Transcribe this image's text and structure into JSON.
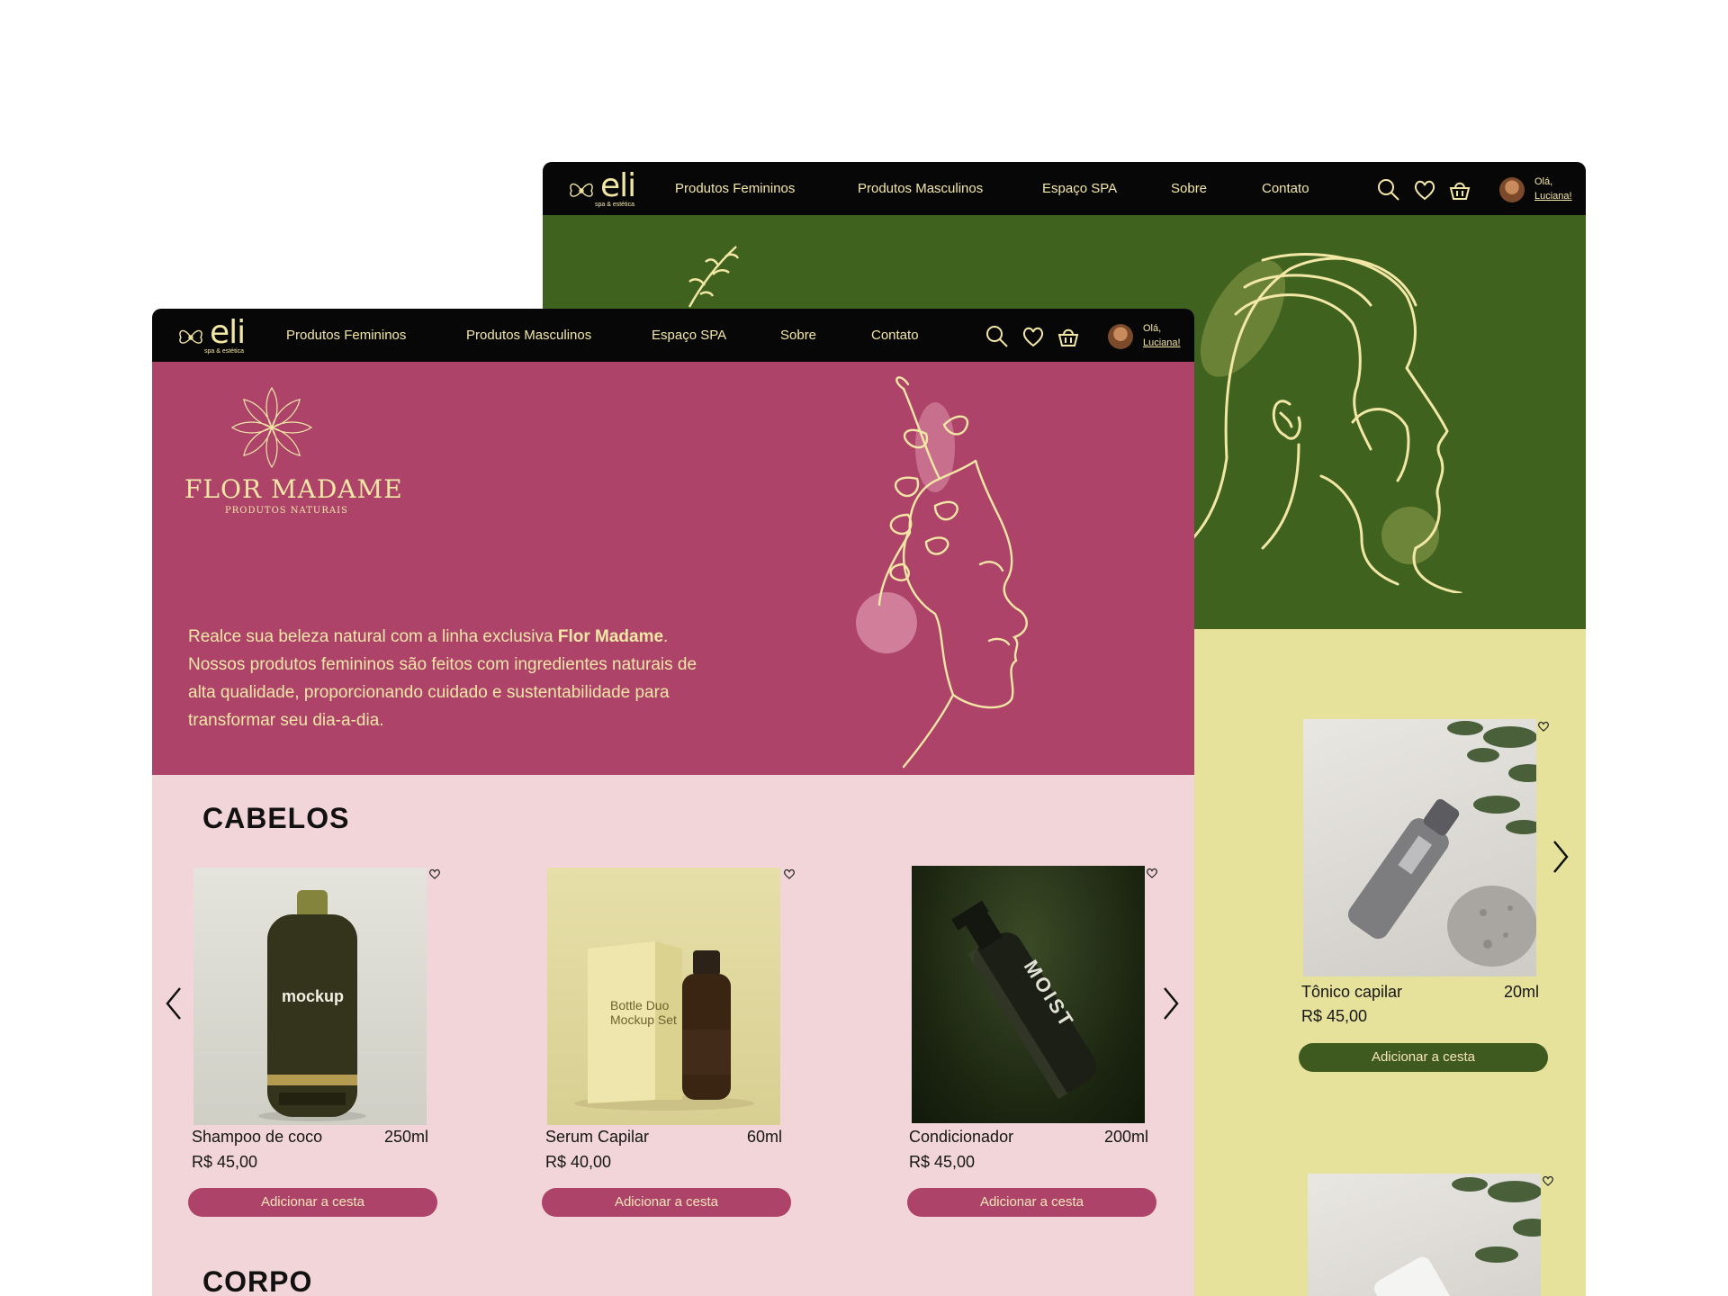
{
  "nav": {
    "logo_word": "eli",
    "logo_tagline": "spa & estética",
    "links": [
      "Produtos Femininos",
      "Produtos Masculinos",
      "Espaço SPA",
      "Sobre",
      "Contato"
    ],
    "greeting_line1": "Olá,",
    "greeting_line2": "Luciana!"
  },
  "feminine": {
    "brand_name": "FLOR MADAME",
    "brand_tagline": "PRODUTOS NATURAIS",
    "intro_before": "Realce sua beleza natural com a linha exclusiva ",
    "intro_brand": "Flor Madame",
    "intro_after": ". Nossos produtos femininos são feitos com ingredientes naturais de alta qualidade, proporcionando cuidado e sustentabilidade para transformar seu dia-a-dia.",
    "sections": [
      "CABELOS",
      "CORPO"
    ],
    "products": [
      {
        "name": "Shampoo de coco",
        "volume": "250ml",
        "price": "R$ 45,00",
        "button": "Adicionar a cesta"
      },
      {
        "name": "Serum Capilar",
        "volume": "60ml",
        "price": "R$ 40,00",
        "button": "Adicionar a cesta"
      },
      {
        "name": "Condicionador",
        "volume": "200ml",
        "price": "R$ 45,00",
        "button": "Adicionar a cesta"
      }
    ],
    "product_labels": [
      "mockup",
      "Bottle Duo Mockup Set",
      "MOIST"
    ]
  },
  "masculine": {
    "products": [
      {
        "name": "Tônico capilar",
        "volume": "20ml",
        "price": "R$ 45,00",
        "button": "Adicionar a cesta"
      }
    ]
  },
  "colors": {
    "nav_bg": "#070707",
    "gold": "#f3e7a6",
    "pink_hero": "#ae436a",
    "pink_bg": "#f2d5d8",
    "green_hero": "#3f621e",
    "green_bg": "#e6e29b",
    "green_button": "#3f5a1e"
  }
}
